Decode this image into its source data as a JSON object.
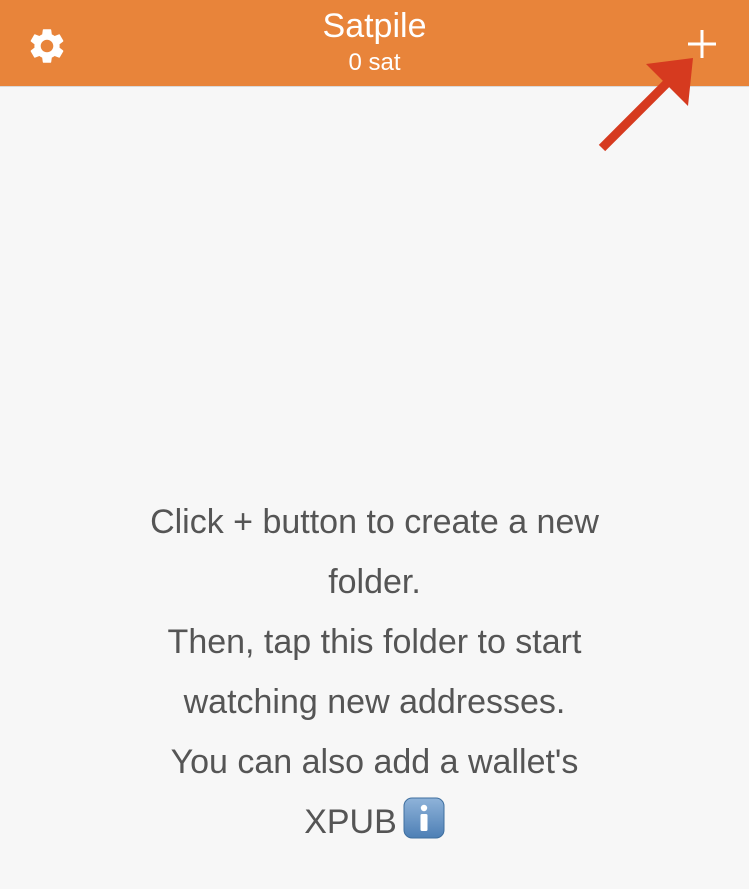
{
  "header": {
    "title": "Satpile",
    "balance": "0 sat",
    "settings_icon": "gear-icon",
    "add_icon": "plus-icon",
    "background_color": "#e8843a",
    "text_color": "#ffffff"
  },
  "annotation": {
    "arrow_icon": "arrow-icon",
    "arrow_color": "#d63a1f"
  },
  "empty_state": {
    "line1": "Click + button to create a new",
    "line2": "folder.",
    "line3": "Then, tap this folder to start",
    "line4": "watching new addresses.",
    "line5": "You can also add a wallet's",
    "line6": "XPUB",
    "info_icon": "info-icon",
    "text_color": "#555555"
  }
}
